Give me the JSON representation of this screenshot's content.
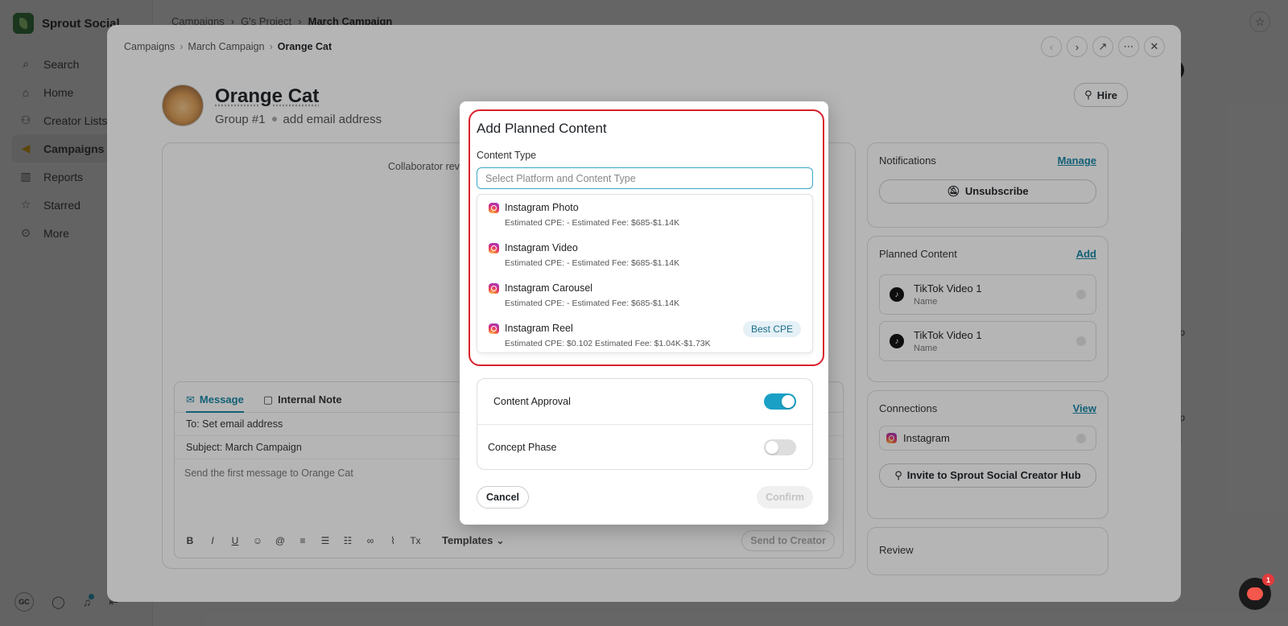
{
  "app": {
    "brand": "Sprout Social",
    "nav": [
      {
        "label": "Search",
        "icon": "search-icon",
        "glyph": "⌕"
      },
      {
        "label": "Home",
        "icon": "home-icon",
        "glyph": "⌂"
      },
      {
        "label": "Creator Lists",
        "icon": "users-icon",
        "glyph": "👥"
      },
      {
        "label": "Campaigns",
        "icon": "megaphone-icon",
        "glyph": "📣"
      },
      {
        "label": "Reports",
        "icon": "bar-chart-icon",
        "glyph": "▥"
      },
      {
        "label": "Starred",
        "icon": "star-icon",
        "glyph": "☆"
      },
      {
        "label": "More",
        "icon": "more-icon",
        "glyph": "⊙"
      }
    ],
    "user_initials": "GC"
  },
  "background": {
    "breadcrumb": [
      "Campaigns",
      "G's Project",
      "March Campaign"
    ],
    "pill_text": "ator",
    "right_snippets": [
      "t Prep",
      "or",
      "t Prep"
    ]
  },
  "drawer": {
    "breadcrumb": [
      "Campaigns",
      "March Campaign",
      "Orange Cat"
    ],
    "creator": {
      "name": "Orange Cat",
      "group": "Group #1",
      "email_placeholder": "add email address"
    },
    "hire_label": "Hire",
    "collab_text": "Collaborator rev",
    "composer": {
      "tabs": [
        "Message",
        "Internal Note"
      ],
      "to_label": "To:",
      "to_value": "Set email address",
      "subject_label": "Subject:",
      "subject_value": "March Campaign",
      "body_placeholder": "Send the first message to Orange Cat",
      "templates_label": "Templates",
      "send_label": "Send to Creator"
    },
    "notifications": {
      "title": "Notifications",
      "action": "Manage",
      "button": "Unsubscribe"
    },
    "planned_content": {
      "title": "Planned Content",
      "action": "Add",
      "items": [
        {
          "title": "TikTok Video 1",
          "sub": "Name"
        },
        {
          "title": "TikTok Video 1",
          "sub": "Name"
        }
      ]
    },
    "connections": {
      "title": "Connections",
      "action": "View",
      "item": "Instagram",
      "invite": "Invite to Sprout Social Creator Hub"
    },
    "review": {
      "title": "Review"
    }
  },
  "modal": {
    "title": "Add Planned Content",
    "content_type_label": "Content Type",
    "placeholder": "Select Platform and Content Type",
    "options": [
      {
        "name": "Instagram Photo",
        "meta": "Estimated CPE: -   Estimated Fee: $685-$1.14K",
        "badge": ""
      },
      {
        "name": "Instagram Video",
        "meta": "Estimated CPE: -   Estimated Fee: $685-$1.14K",
        "badge": ""
      },
      {
        "name": "Instagram Carousel",
        "meta": "Estimated CPE: -   Estimated Fee: $685-$1.14K",
        "badge": ""
      },
      {
        "name": "Instagram Reel",
        "meta": "Estimated CPE: $0.102   Estimated Fee: $1.04K-$1.73K",
        "badge": "Best CPE"
      }
    ],
    "toggles": [
      {
        "label": "Content Approval",
        "on": true
      },
      {
        "label": "Concept Phase",
        "on": false
      }
    ],
    "cancel_label": "Cancel",
    "confirm_label": "Confirm"
  },
  "chat": {
    "badge": "1"
  },
  "colors": {
    "accent": "#1aa0c4",
    "highlight": "#d9212b",
    "link": "#1887a7"
  }
}
